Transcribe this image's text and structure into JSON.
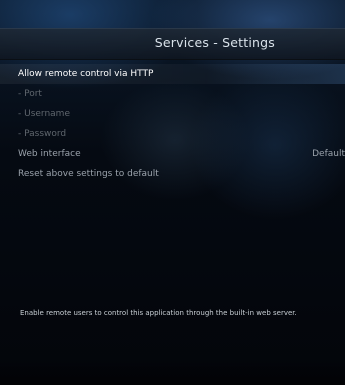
{
  "header": {
    "title": "Services - Settings"
  },
  "settings": [
    {
      "label": "Allow remote control via HTTP",
      "value": "",
      "state": "focused"
    },
    {
      "label": "- Port",
      "value": "",
      "state": "disabled"
    },
    {
      "label": "- Username",
      "value": "",
      "state": "disabled"
    },
    {
      "label": "- Password",
      "value": "",
      "state": "disabled"
    },
    {
      "label": "Web interface",
      "value": "Default",
      "state": "normal"
    },
    {
      "label": "Reset above settings to default",
      "value": "",
      "state": "normal"
    }
  ],
  "description": "Enable remote users to control this application through the built-in web server."
}
